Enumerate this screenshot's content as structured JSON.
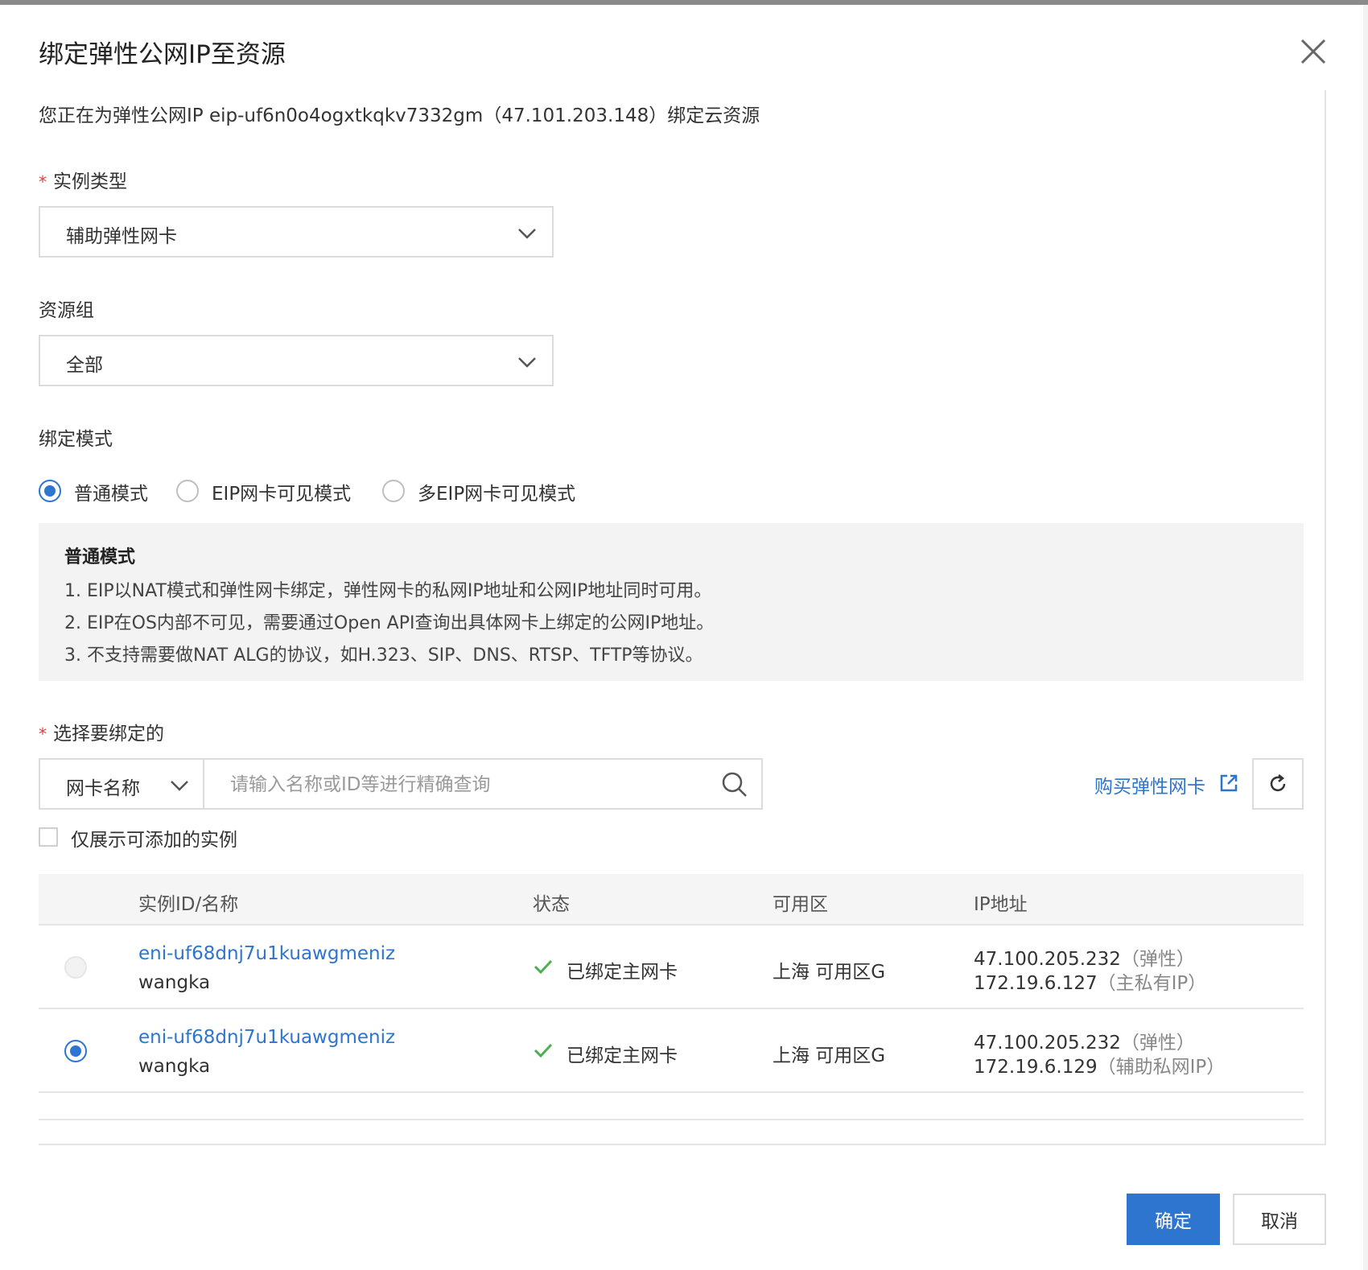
{
  "dialog": {
    "title": "绑定弹性公网IP至资源",
    "intro": "您正在为弹性公网IP eip-uf6n0o4ogxtkqkv7332gm（47.101.203.148）绑定云资源"
  },
  "instance_type": {
    "required_mark": "*",
    "label": "实例类型",
    "value": "辅助弹性网卡"
  },
  "resource_group": {
    "label": "资源组",
    "value": "全部"
  },
  "bind_mode": {
    "label": "绑定模式",
    "options": [
      {
        "label": "普通模式",
        "checked": true
      },
      {
        "label": "EIP网卡可见模式",
        "checked": false
      },
      {
        "label": "多EIP网卡可见模式",
        "checked": false
      }
    ],
    "info": {
      "title": "普通模式",
      "lines": [
        "1. EIP以NAT模式和弹性网卡绑定，弹性网卡的私网IP地址和公网IP地址同时可用。",
        "2. EIP在OS内部不可见，需要通过Open API查询出具体网卡上绑定的公网IP地址。",
        "3. 不支持需要做NAT ALG的协议，如H.323、SIP、DNS、RTSP、TFTP等协议。"
      ]
    }
  },
  "select_target": {
    "required_mark": "*",
    "label": "选择要绑定的",
    "filter_value": "网卡名称",
    "search_placeholder": "请输入名称或ID等进行精确查询",
    "buy_link": "购买弹性网卡",
    "only_addable_label": "仅展示可添加的实例"
  },
  "table": {
    "headers": [
      "实例ID/名称",
      "状态",
      "可用区",
      "IP地址"
    ],
    "rows": [
      {
        "id": "eni-uf68dnj7u1kuawgmeniz",
        "name": "wangka",
        "status": "已绑定主网卡",
        "zone": "上海 可用区G",
        "ip1": "47.100.205.232",
        "ip1_note": "（弹性）",
        "ip2": "172.19.6.127",
        "ip2_note": "（主私有IP）",
        "selected": false,
        "selectable": false
      },
      {
        "id": "eni-uf68dnj7u1kuawgmeniz",
        "name": "wangka",
        "status": "已绑定主网卡",
        "zone": "上海 可用区G",
        "ip1": "47.100.205.232",
        "ip1_note": "（弹性）",
        "ip2": "172.19.6.129",
        "ip2_note": "（辅助私网IP）",
        "selected": true,
        "selectable": true
      }
    ]
  },
  "footer": {
    "ok_label": "确定",
    "cancel_label": "取消"
  },
  "colors": {
    "primary": "#2d75ce",
    "success": "#4caf50",
    "required": "#e23c39"
  },
  "icons": {
    "close": "close-icon",
    "dropdown": "chevron-down-icon",
    "search": "search-icon",
    "external_link": "external-link-icon",
    "refresh": "refresh-icon",
    "status_ok": "check-icon"
  }
}
